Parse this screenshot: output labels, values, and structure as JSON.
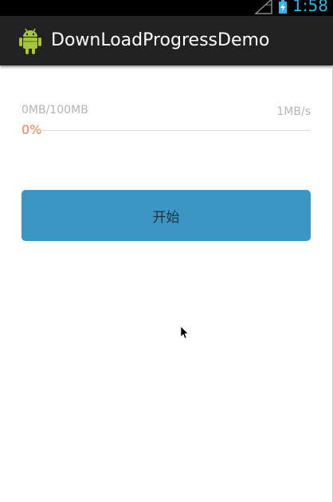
{
  "status_bar": {
    "time": "1:58",
    "icons": [
      "signal-icon",
      "battery-charging-icon"
    ]
  },
  "action_bar": {
    "title": "DownLoadProgressDemo",
    "icon": "android-robot-icon"
  },
  "download": {
    "size_label": "0MB/100MB",
    "speed_label": "1MB/s",
    "percent_label": "0%",
    "progress": 0
  },
  "button": {
    "label": "开始"
  },
  "colors": {
    "status_accent": "#33b5e5",
    "action_bar_bg": "#222222",
    "progress_accent": "#f47e50",
    "button_bg": "#3b96c4",
    "muted_text": "#b4b4b4"
  }
}
